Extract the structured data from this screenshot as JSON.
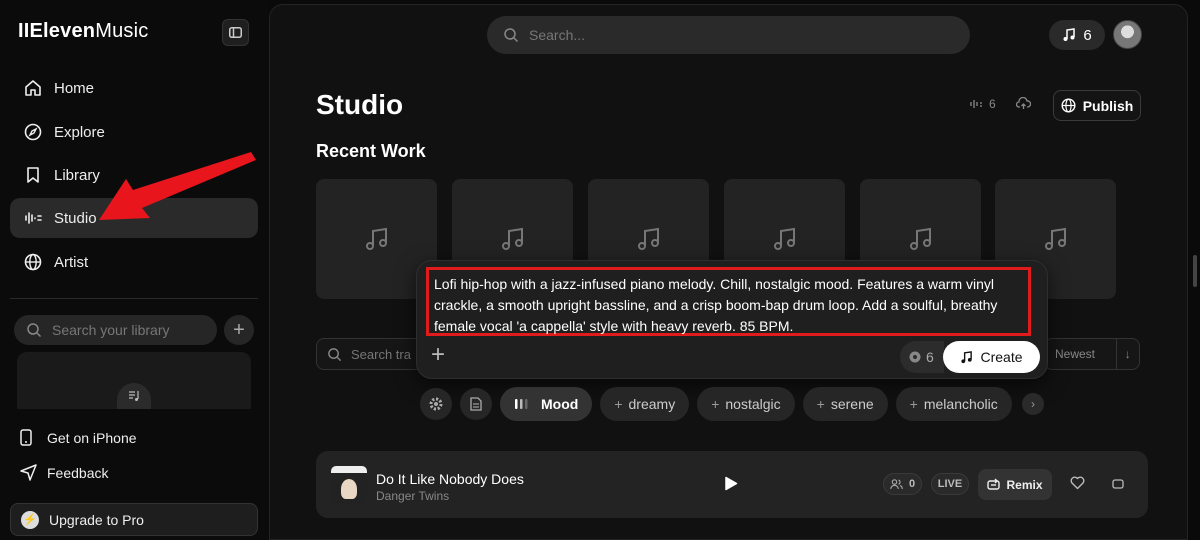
{
  "app": {
    "logo_prefix": "II",
    "logo_bold": "Eleven",
    "logo_rest": "Music"
  },
  "sidebar": {
    "nav": [
      {
        "label": "Home",
        "icon": "home-icon"
      },
      {
        "label": "Explore",
        "icon": "compass-icon"
      },
      {
        "label": "Library",
        "icon": "bookmark-icon"
      },
      {
        "label": "Studio",
        "icon": "studio-icon",
        "active": true
      },
      {
        "label": "Artist",
        "icon": "globe-icon"
      }
    ],
    "library_search_placeholder": "Search your library",
    "get_iphone": "Get on iPhone",
    "feedback": "Feedback",
    "upgrade": "Upgrade to Pro"
  },
  "header": {
    "search_placeholder": "Search...",
    "credits": "6"
  },
  "studio": {
    "title": "Studio",
    "stat_count": "6",
    "publish_label": "Publish",
    "recent_work_title": "Recent Work",
    "filter_placeholder": "Search tra",
    "sort_label": "Newest"
  },
  "composer": {
    "prompt": "Lofi hip-hop with a jazz-infused piano melody. Chill, nostalgic mood. Features a warm vinyl crackle, a smooth upright bassline, and a crisp boom-bap drum loop. Add a soulful, breathy female vocal 'a cappella' style with heavy reverb. 85 BPM.",
    "cost": "6",
    "create_label": "Create",
    "mood_label": "Mood",
    "chips": [
      "dreamy",
      "nostalgic",
      "serene",
      "melancholic"
    ]
  },
  "track": {
    "title": "Do It Like Nobody Does",
    "artist": "Danger Twins",
    "listeners": "0",
    "badge": "LIVE",
    "remix_label": "Remix"
  },
  "colors": {
    "highlight": "#e01b1b",
    "accent_arrow": "#e8161c"
  }
}
